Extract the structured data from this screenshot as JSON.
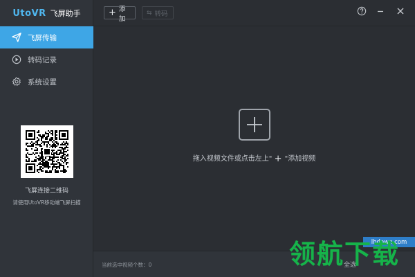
{
  "app": {
    "brand": "UtoVR",
    "title": "飞屏助手"
  },
  "toolbar": {
    "add_label": "添加",
    "convert_label": "转码"
  },
  "sidebar": {
    "items": [
      {
        "label": "飞屏传输",
        "icon": "send-icon",
        "active": true
      },
      {
        "label": "转码记录",
        "icon": "play-circle-icon",
        "active": false
      },
      {
        "label": "系统设置",
        "icon": "gear-icon",
        "active": false
      }
    ],
    "qr_caption": "飞屏连接二维码",
    "qr_hint": "请使用UtoVR移动端飞屏扫描"
  },
  "main": {
    "drop_hint_before": "拖入视频文件或点击左上\"",
    "drop_hint_after": "\"添加视频"
  },
  "status": {
    "selected_text": "当前选中视频个数：0",
    "select_all": "全选"
  },
  "watermark": {
    "site": "lhdown.com",
    "text": "领航下载"
  },
  "colors": {
    "accent": "#3ea6e6",
    "background": "#2b2e33",
    "sidebar": "#30343a",
    "watermark_green": "#16b34a"
  }
}
